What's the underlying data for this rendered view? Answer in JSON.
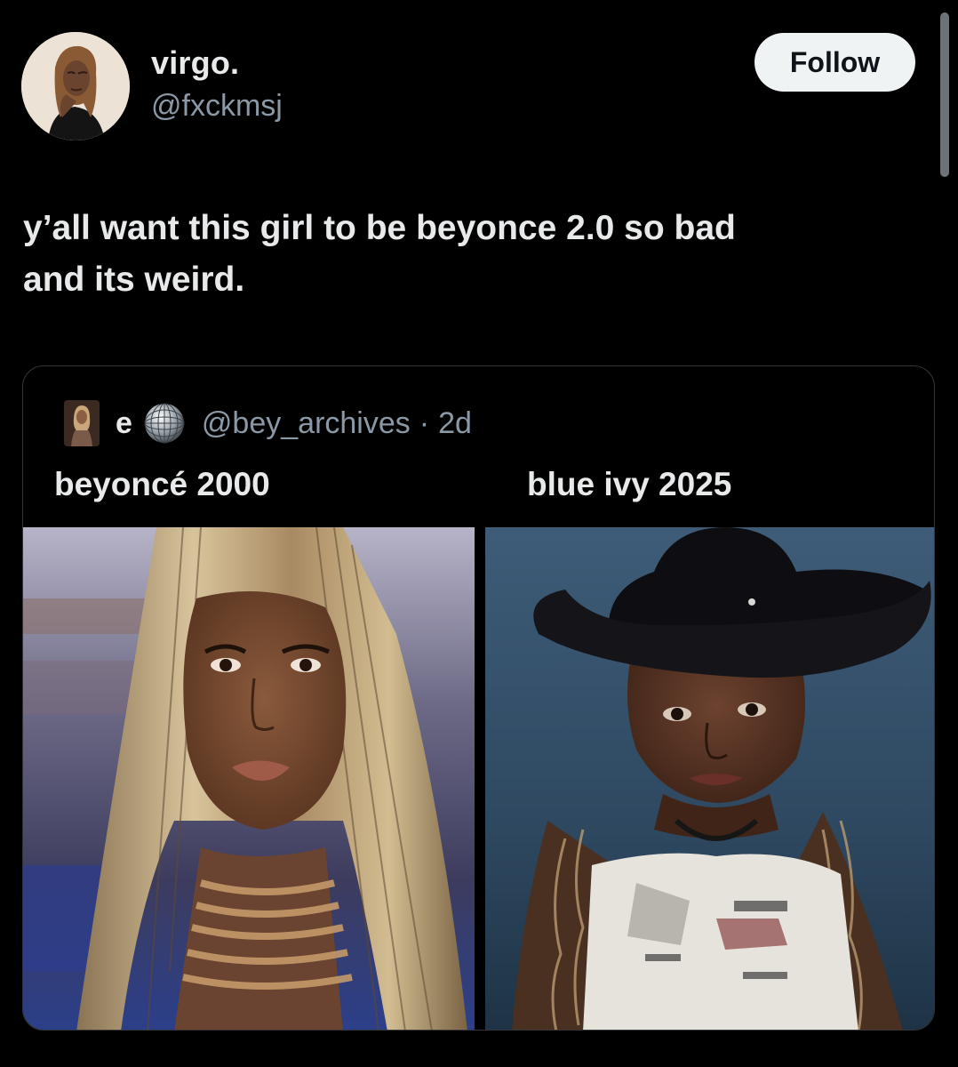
{
  "author": {
    "display_name": "virgo.",
    "handle": "@fxckmsj",
    "avatar_icon": "profile-photo"
  },
  "follow_button": {
    "label": "Follow"
  },
  "tweet": {
    "text": "y’all want this girl to be beyonce 2.0 so bad\nand its weird."
  },
  "quoted_tweet": {
    "display_name": "e",
    "name_emoji_icon": "disco-ball-icon",
    "handle": "@bey_archives",
    "separator": "·",
    "time": "2d",
    "caption_left": "beyoncé 2000",
    "caption_right": "blue ivy 2025",
    "images": [
      {
        "subject": "photo-left"
      },
      {
        "subject": "photo-right"
      }
    ]
  },
  "colors": {
    "background": "#000000",
    "text_primary": "#e7e9ea",
    "text_secondary": "#8b98a5",
    "follow_bg": "#eff3f4",
    "border": "#333639"
  }
}
